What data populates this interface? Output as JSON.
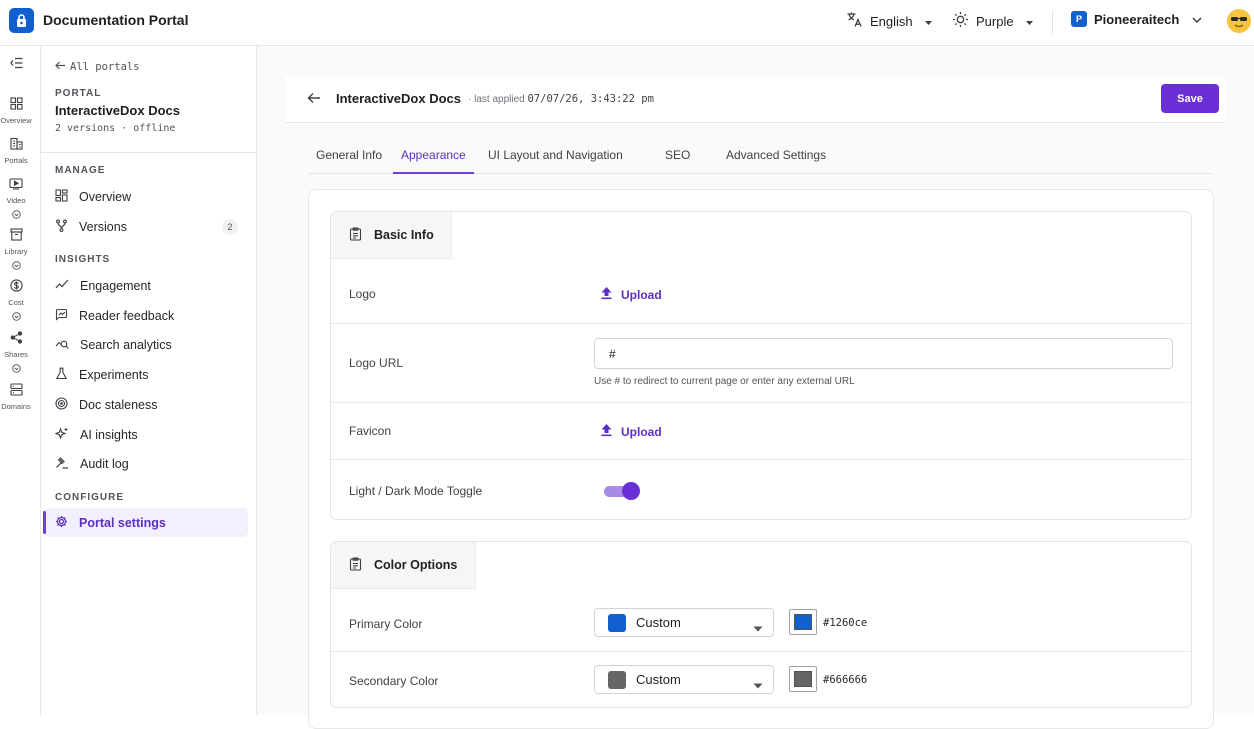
{
  "app": {
    "title": "Documentation Portal"
  },
  "topbar": {
    "language": "English",
    "theme": "Purple",
    "org_badge": "P",
    "org": "Pioneeraitech"
  },
  "rail": {
    "items": [
      {
        "label": "Overview",
        "icon": "grid-icon"
      },
      {
        "label": "Portals",
        "icon": "building-icon"
      },
      {
        "label": "Video",
        "icon": "video-icon"
      },
      {
        "label": "Library",
        "icon": "archive-icon"
      },
      {
        "label": "Cost",
        "icon": "dollar-icon"
      },
      {
        "label": "Shares",
        "icon": "share-icon"
      },
      {
        "label": "Domains",
        "icon": "server-icon"
      }
    ]
  },
  "sidebar": {
    "back": "All portals",
    "kicker": "PORTAL",
    "portal_name": "InteractiveDox Docs",
    "portal_meta": "2 versions · offline",
    "manage_head": "MANAGE",
    "insights_head": "INSIGHTS",
    "configure_head": "CONFIGURE",
    "manage": [
      {
        "label": "Overview",
        "icon": "grid-icon"
      },
      {
        "label": "Versions",
        "icon": "branch-icon",
        "badge": "2"
      }
    ],
    "insights": [
      {
        "label": "Engagement",
        "icon": "trend-icon"
      },
      {
        "label": "Reader feedback",
        "icon": "feedback-icon"
      },
      {
        "label": "Search analytics",
        "icon": "search-analytics-icon"
      },
      {
        "label": "Experiments",
        "icon": "flask-icon"
      },
      {
        "label": "Doc staleness",
        "icon": "radar-icon"
      },
      {
        "label": "AI insights",
        "icon": "sparkles-icon"
      },
      {
        "label": "Audit log",
        "icon": "gavel-icon"
      }
    ],
    "configure": [
      {
        "label": "Portal settings",
        "icon": "gear-icon",
        "active": true
      }
    ]
  },
  "page": {
    "title": "InteractiveDox Docs",
    "last_applied_label": "· last applied",
    "last_applied_value": "07/07/26, 3:43:22 pm",
    "save_label": "Save"
  },
  "tabs": [
    {
      "label": "General Info"
    },
    {
      "label": "Appearance",
      "active": true
    },
    {
      "label": "UI Layout and Navigation"
    },
    {
      "label": "SEO"
    },
    {
      "label": "Advanced Settings"
    }
  ],
  "basic_info": {
    "title": "Basic Info",
    "logo_label": "Logo",
    "upload_label": "Upload",
    "logo_url_label": "Logo URL",
    "logo_url_value": "#",
    "logo_url_helper": "Use # to redirect to current page or enter any external URL",
    "favicon_label": "Favicon",
    "toggle_label": "Light / Dark Mode Toggle",
    "toggle_on": true
  },
  "color_options": {
    "title": "Color Options",
    "primary_label": "Primary Color",
    "primary_mode": "Custom",
    "primary_hex": "#1260ce",
    "secondary_label": "Secondary Color",
    "secondary_mode": "Custom",
    "secondary_hex": "#666666"
  }
}
